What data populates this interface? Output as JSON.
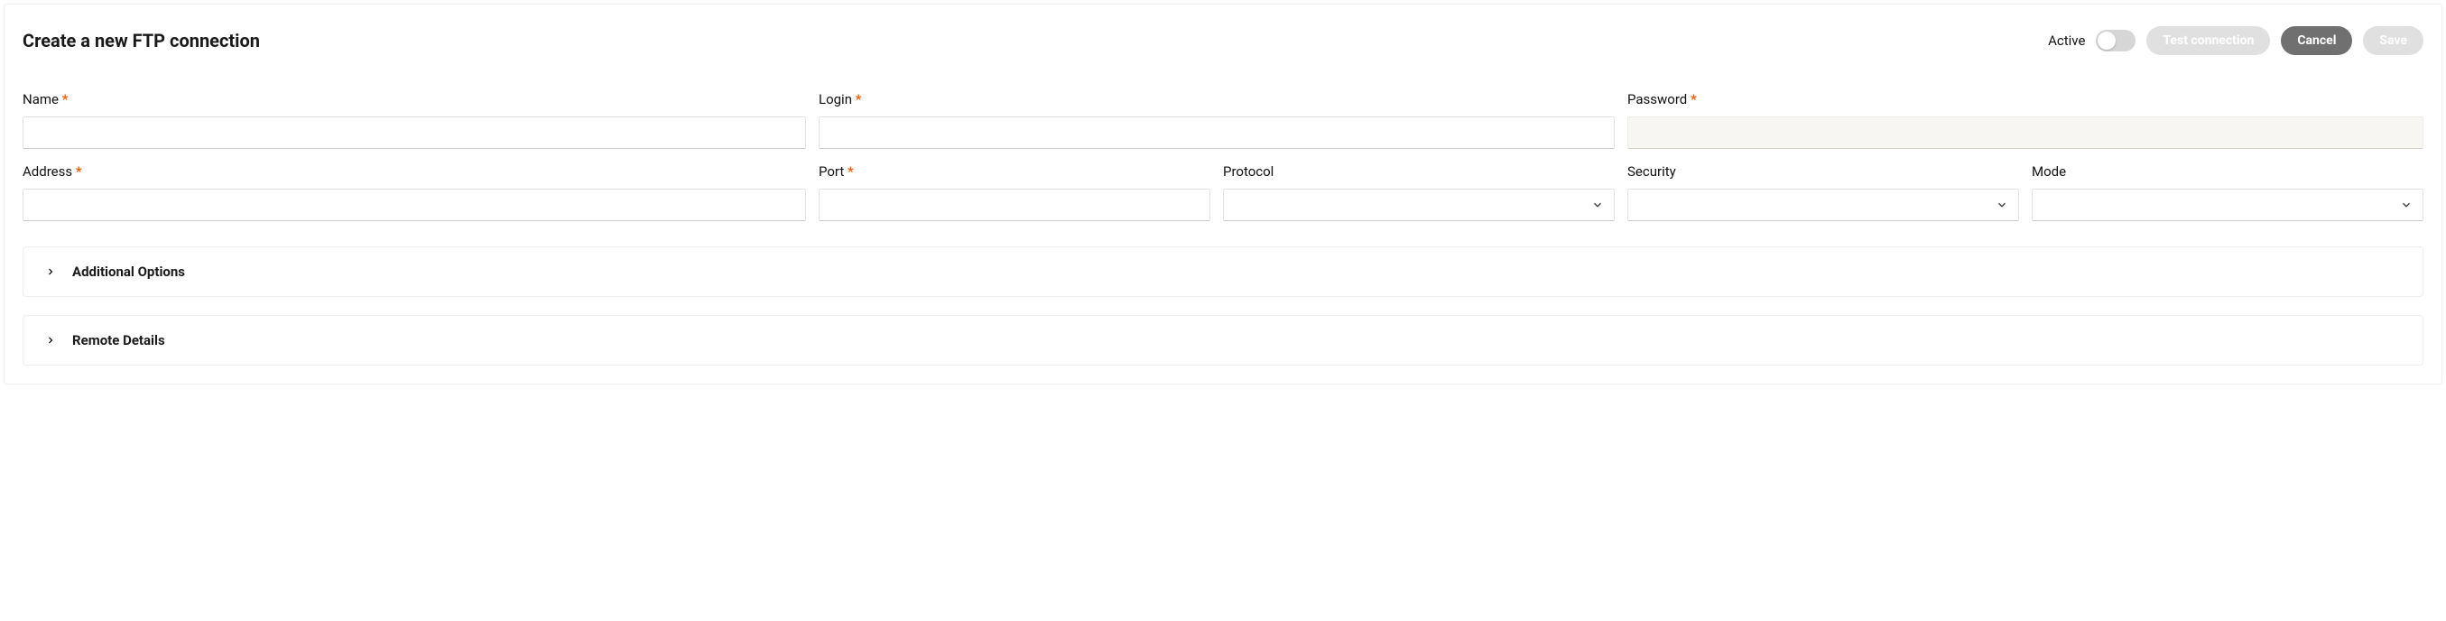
{
  "header": {
    "title": "Create a new FTP connection",
    "active_label": "Active",
    "test_label": "Test connection",
    "cancel_label": "Cancel",
    "save_label": "Save"
  },
  "fields": {
    "name": {
      "label": "Name",
      "required": true,
      "value": ""
    },
    "login": {
      "label": "Login",
      "required": true,
      "value": ""
    },
    "password": {
      "label": "Password",
      "required": true,
      "value": ""
    },
    "address": {
      "label": "Address",
      "required": true,
      "value": ""
    },
    "port": {
      "label": "Port",
      "required": true,
      "value": ""
    },
    "protocol": {
      "label": "Protocol",
      "required": false,
      "value": ""
    },
    "security": {
      "label": "Security",
      "required": false,
      "value": ""
    },
    "mode": {
      "label": "Mode",
      "required": false,
      "value": ""
    }
  },
  "required_mark": "*",
  "sections": {
    "additional": "Additional Options",
    "remote": "Remote Details"
  }
}
